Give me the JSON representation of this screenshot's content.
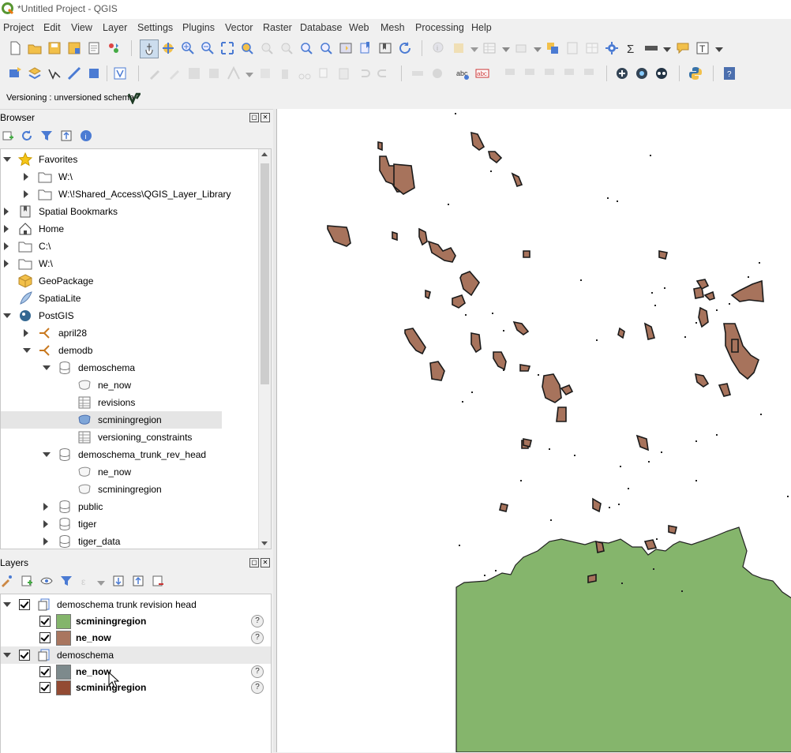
{
  "window": {
    "title": "*Untitled Project - QGIS"
  },
  "menu": [
    "Project",
    "Edit",
    "View",
    "Layer",
    "Settings",
    "Plugins",
    "Vector",
    "Raster",
    "Database",
    "Web",
    "Mesh",
    "Processing",
    "Help"
  ],
  "versioning": {
    "label": "Versioning : unversioned schema"
  },
  "browser": {
    "title": "Browser",
    "items": [
      {
        "label": "Favorites"
      },
      {
        "label": "W:\\"
      },
      {
        "label": "W:\\!Shared_Access\\QGIS_Layer_Library"
      },
      {
        "label": "Spatial Bookmarks"
      },
      {
        "label": "Home"
      },
      {
        "label": "C:\\"
      },
      {
        "label": "W:\\"
      },
      {
        "label": "GeoPackage"
      },
      {
        "label": "SpatiaLite"
      },
      {
        "label": "PostGIS"
      },
      {
        "label": "april28"
      },
      {
        "label": "demodb"
      },
      {
        "label": "demoschema"
      },
      {
        "label": "ne_now"
      },
      {
        "label": "revisions"
      },
      {
        "label": "scminingregion"
      },
      {
        "label": "versioning_constraints"
      },
      {
        "label": "demoschema_trunk_rev_head"
      },
      {
        "label": "ne_now"
      },
      {
        "label": "scminingregion"
      },
      {
        "label": "public"
      },
      {
        "label": "tiger"
      },
      {
        "label": "tiger_data"
      }
    ]
  },
  "layers": {
    "title": "Layers",
    "groups": [
      {
        "name": "demoschema trunk revision head",
        "layers": [
          {
            "name": "scminingregion",
            "color": "#84b56b"
          },
          {
            "name": "ne_now",
            "color": "#a9765f"
          }
        ]
      },
      {
        "name": "demoschema",
        "layers": [
          {
            "name": "ne_now",
            "color": "#7d8a8c"
          },
          {
            "name": "scminingregion",
            "color": "#934b33"
          }
        ]
      }
    ],
    "help_glyph": "?"
  },
  "map": {
    "land_color": "#85b56c",
    "feature_color": "#a7735c"
  }
}
